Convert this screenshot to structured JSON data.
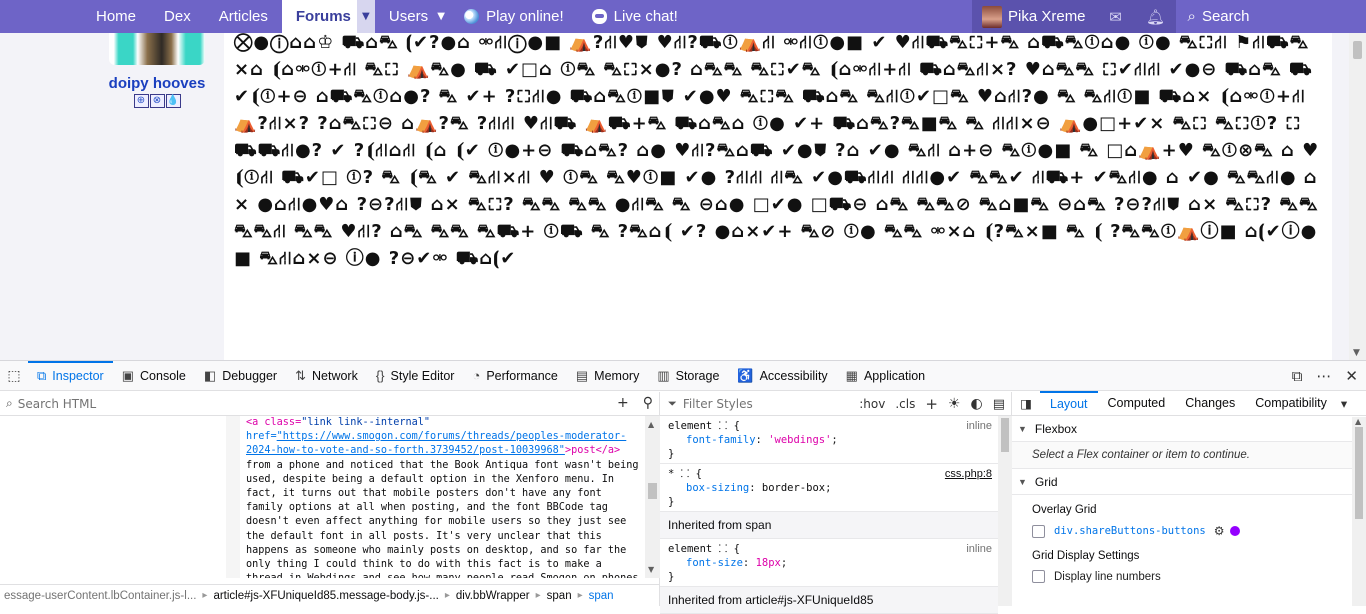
{
  "nav": {
    "items": [
      {
        "label": "Home",
        "dropdown": false
      },
      {
        "label": "Dex",
        "dropdown": false
      },
      {
        "label": "Articles",
        "dropdown": false
      },
      {
        "label": "Forums",
        "dropdown": true,
        "active": true
      },
      {
        "label": "Users",
        "dropdown": true
      },
      {
        "label": "Play online!",
        "icon": "globe-icon"
      },
      {
        "label": "Live chat!",
        "icon": "chat-icon"
      }
    ],
    "username": "Pika Xreme",
    "search_label": "Search",
    "caret": "▼"
  },
  "post": {
    "author": "doipy hooves",
    "badges": [
      "⊕",
      "⊗",
      "💧"
    ],
    "wingdings_text": "⛒●ⓘ⌂⌂♔ ⛟⌂⛍ ⦗✔?●⌂ ⚮⛙ⓘ●■ ⛺?⛙♥⛊ ♥⛙?⛟ⓘ⛺⛙ ⚮⛙ⓘ●■ ✔ ♥⛙⛟⛍⛶+⛍ ⌂⛟⛍ⓘ⌂● ⓘ● ⛍⛶⛙ ⚑⛙⛟⛍×⌂ ⦗⌂⚮ⓘ+⛙ ⛍⛶ ⛺⛍● ⛟ ✔□⌂ ⓘ⛍ ⛍⛶×●? ⌂⛍⛍ ⛍⛶✔⛍ ⦗⌂⚮⛙+⛙ ⛟⌂⛍⛙×? ♥⌂⛍⛍ ⛶✔⛙⛙ ✔●⊖ ⛟⌂⛍ ⛟✔⦗ⓘ+⊖ ⌂⛟⛍ⓘ⌂●? ⛍ ✔+ ?⛶⛙● ⛟⌂⛍ⓘ■⛊ ✔●♥ ⛍⛶⛍ ⛟⌂⛍ ⛍⛙ⓘ✔□⛍ ♥⌂⛙?● ⛍ ⛍⛙ⓘ■ ⛟⌂× ⦗⌂⚮ⓘ+⛙ ⛺?⛙×? ?⌂⛍⛶⊖ ⌂⛺?⛍ ?⛙⛙ ♥⛙⛟ ⛺⛟+⛍ ⛟⌂⛍⌂ ⓘ● ✔+ ⛟⌂⛍?⛍■⛍ ⛍ ⛙⛙×⊖ ⛺●□+✔× ⛍⛶ ⛍⛶ⓘ? ⛶⛟⛟⛙●? ✔ ?⦗⛙⌂⛙ ⦗⌂ ⦗✔ ⓘ●+⊖ ⛟⌂⛍? ⌂● ♥⛙?⛍⌂⛟ ✔●⛊ ?⌂ ✔● ⛍⛙ ⌂+⊖ ⛍ⓘ●■ ⛍ □⌂⛺+♥ ⛍ⓘ⊗⛍ ⌂ ♥ ⦗ⓘ⛙ ⛟✔□ ⓘ? ⛍ ⦗⛍ ✔ ⛍⛙×⛙ ♥ ⓘ⛍ ⛍♥ⓘ■ ✔● ?⛙⛙ ⛙⛍ ✔●⛟⛙⛙ ⛙⛙●✔ ⛍⛍✔ ⛙⛟+ ✔⛍⛙● ⌂ ✔● ⛍⛍⛙● ⌂× ●⌂⛙●♥⌂ ?⊖?⛙⛊ ⌂× ⛍⛶? ⛍⛍ ⛍⛍ ●⛙⛍ ⛍ ⊖⌂● □✔● □⛟⊖ ⌂⛍ ⛍⛍⊘ ⛍⌂■⛍ ⊖⌂⛍ ?⊖?⛙⛊ ⌂× ⛍⛶? ⛍⛍ ⛍⛍⛙ ⛍⛍ ♥⛙? ⌂⛍ ⛍⛍ ⛍⛟+ ⓘ⛟ ⛍ ?⛍⌂⦗ ✔? ●⌂×✔+ ⛍⊘ ⓘ● ⛍⛍ ⚮×⌂ ⦗?⛍×■ ⛍ ⦗ ?⛍⛍ⓘ⛺ⓘ■ ⌂⦗✔ⓘ●■ ⛍⛙⌂×⊖ ⓘ● ?⊖✔⚮ ⛟⌂⦗✔"
  },
  "devtools": {
    "tabs": [
      {
        "label": "Inspector",
        "icon": "inspector-icon",
        "glyph": "⧉",
        "active": true
      },
      {
        "label": "Console",
        "icon": "console-icon",
        "glyph": "▣"
      },
      {
        "label": "Debugger",
        "icon": "debugger-icon",
        "glyph": "◧"
      },
      {
        "label": "Network",
        "icon": "network-icon",
        "glyph": "⇅"
      },
      {
        "label": "Style Editor",
        "icon": "style-editor-icon",
        "glyph": "{}"
      },
      {
        "label": "Performance",
        "icon": "performance-icon",
        "glyph": "◔"
      },
      {
        "label": "Memory",
        "icon": "memory-icon",
        "glyph": "▤"
      },
      {
        "label": "Storage",
        "icon": "storage-icon",
        "glyph": "▥"
      },
      {
        "label": "Accessibility",
        "icon": "accessibility-icon",
        "glyph": "♿"
      },
      {
        "label": "Application",
        "icon": "application-icon",
        "glyph": "▦"
      }
    ],
    "markup": {
      "search_placeholder": "Search HTML",
      "code_line1_tag": "<a class=",
      "code_line1_attr": "\"link link--internal\"",
      "code_line1_href": " href=",
      "code_line1_url": "\"https://www.smogon.com/forums/threads/peoples-moderator-2024-how-to-vote-and-so-forth.3739452/post-10039968\"",
      "code_line1_close": ">post</a>",
      "code_text": "from a phone and noticed that the Book Antiqua font wasn't being used, despite being a default option in the Xenforo menu. In fact, it turns out that mobile posters don't have any font family options at all when posting, and the font BBCode tag doesn't even affect anything for mobile users so they just see the default font in all posts. It's very unclear that this happens as someone who mainly posts on desktop, and so far the only thing I could think to do with this fact is to make a thread in Webdings and see how many people read Smogon on phones or a non-Windows system, or just",
      "breadcrumbs": [
        "essage-userContent.lbContainer.js-l...",
        "article#js-XFUniqueId85.message-body.js-...",
        "div.bbWrapper",
        "span",
        "span"
      ]
    },
    "rules": {
      "filter_placeholder": "Filter Styles",
      "hov": ":hov",
      "cls": ".cls",
      "rule1": {
        "selector": "element ⸬ {",
        "prop": "font-family",
        "value": "'webdings'",
        "source": "inline"
      },
      "rule2": {
        "selector": "* ⸬ {",
        "prop": "box-sizing",
        "value": "border-box",
        "source": "css.php:8"
      },
      "inherited1": "Inherited from span",
      "rule3": {
        "selector": "element ⸬ {",
        "prop": "font-size",
        "value": "18px",
        "source": "inline"
      },
      "inherited2": "Inherited from article#js-XFUniqueId85"
    },
    "layout": {
      "tabs": [
        "Layout",
        "Computed",
        "Changes",
        "Compatibility"
      ],
      "flexbox_title": "Flexbox",
      "flexbox_hint": "Select a Flex container or item to continue.",
      "grid_title": "Grid",
      "overlay_grid": "Overlay Grid",
      "overlay_item": "div.shareButtons-buttons",
      "grid_display_settings": "Grid Display Settings",
      "display_line_numbers": "Display line numbers"
    }
  }
}
